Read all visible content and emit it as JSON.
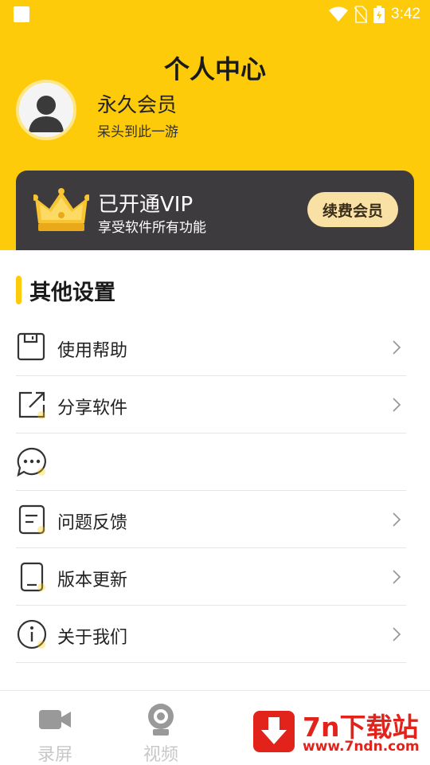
{
  "status_bar": {
    "time": "3:42",
    "icons": [
      "notification-square-icon",
      "wifi-icon",
      "no-sim-icon",
      "battery-charging-icon"
    ]
  },
  "header": {
    "title": "个人中心",
    "background_color": "#FDCB0A"
  },
  "profile": {
    "name": "永久会员",
    "subtitle": "呆头到此一游"
  },
  "vip_card": {
    "title": "已开通VIP",
    "subtitle": "享受软件所有功能",
    "renew_label": "续费会员",
    "card_color": "#3E3B3E",
    "button_color": "#F9E1A6"
  },
  "settings": {
    "section_title": "其他设置",
    "items": [
      {
        "label": "使用帮助",
        "icon": "floppy-disk-icon"
      },
      {
        "label": "分享软件",
        "icon": "share-icon"
      },
      {
        "label": "",
        "icon": "chat-bubble-icon"
      },
      {
        "label": "问题反馈",
        "icon": "feedback-document-icon"
      },
      {
        "label": "版本更新",
        "icon": "phone-update-icon"
      },
      {
        "label": "关于我们",
        "icon": "info-icon"
      }
    ]
  },
  "bottom_nav": {
    "items": [
      {
        "label": "录屏",
        "icon": "video-camera-icon"
      },
      {
        "label": "视频",
        "icon": "webcam-icon"
      }
    ]
  },
  "watermark": {
    "title": "7n下载站",
    "url": "www.7ndn.com",
    "color": "#E1231C"
  }
}
